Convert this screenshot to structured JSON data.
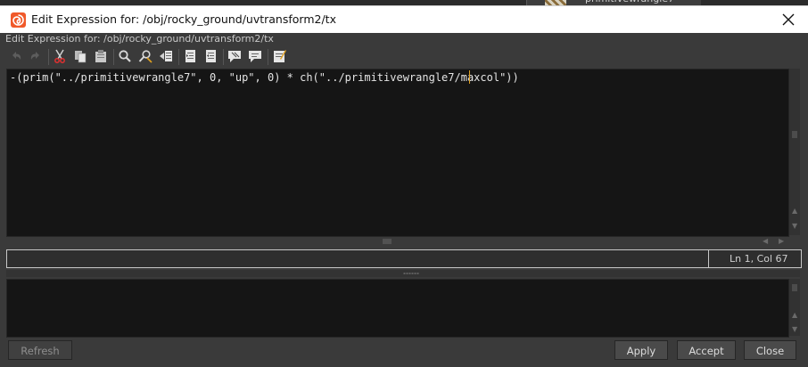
{
  "background_window": {
    "node_label": "primitivewrangle7"
  },
  "window": {
    "title": "Edit Expression for: /obj/rocky_ground/uvtransform2/tx",
    "subtitle": "Edit Expression for: /obj/rocky_ground/uvtransform2/tx"
  },
  "toolbar": {
    "icons": [
      "undo-icon",
      "redo-icon",
      "cut-icon",
      "copy-icon",
      "paste-icon",
      "find-icon",
      "replace-icon",
      "goto-line-icon",
      "indent-icon",
      "unindent-icon",
      "comment-icon",
      "uncomment-icon",
      "settings-icon"
    ]
  },
  "editor": {
    "code": "-(prim(\"../primitivewrangle7\", 0, \"up\", 0) * ch(\"../primitivewrangle7/maxcol\"))"
  },
  "status": {
    "position": "Ln 1, Col 67"
  },
  "buttons": {
    "refresh": "Refresh",
    "apply": "Apply",
    "accept": "Accept",
    "close": "Close"
  },
  "colors": {
    "accent": "#e0a020",
    "houdini_orange": "#f0592a"
  }
}
